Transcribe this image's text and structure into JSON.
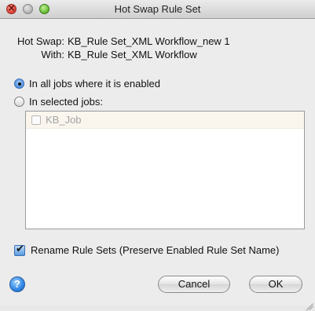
{
  "window": {
    "title": "Hot Swap Rule Set"
  },
  "swap": {
    "hot_swap_label": "Hot Swap:",
    "hot_swap_value": "KB_Rule Set_XML Workflow_new 1",
    "with_label": "With:",
    "with_value": "KB_Rule Set_XML Workflow"
  },
  "options": {
    "all_jobs_label": "In all jobs where it is enabled",
    "all_jobs_selected": true,
    "selected_jobs_label": "In selected jobs:",
    "selected_jobs_selected": false
  },
  "jobs": [
    {
      "label": "KB_Job",
      "checked": false,
      "enabled": false
    }
  ],
  "rename": {
    "label": "Rename Rule Sets (Preserve Enabled Rule Set Name)",
    "checked": true
  },
  "buttons": {
    "help": "?",
    "cancel": "Cancel",
    "ok": "OK"
  },
  "icons": {
    "close": "close-icon",
    "minimize": "minimize-icon",
    "zoom": "zoom-icon",
    "help": "help-icon",
    "resize": "resize-grip-icon"
  }
}
